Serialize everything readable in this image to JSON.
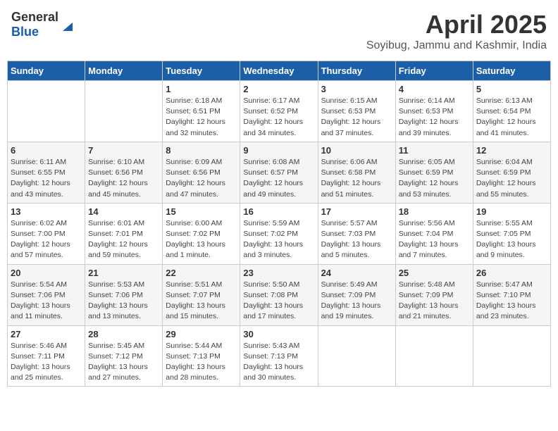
{
  "header": {
    "logo_general": "General",
    "logo_blue": "Blue",
    "title": "April 2025",
    "subtitle": "Soyibug, Jammu and Kashmir, India"
  },
  "days_of_week": [
    "Sunday",
    "Monday",
    "Tuesday",
    "Wednesday",
    "Thursday",
    "Friday",
    "Saturday"
  ],
  "weeks": [
    [
      {
        "day": "",
        "info": ""
      },
      {
        "day": "",
        "info": ""
      },
      {
        "day": "1",
        "info": "Sunrise: 6:18 AM\nSunset: 6:51 PM\nDaylight: 12 hours\nand 32 minutes."
      },
      {
        "day": "2",
        "info": "Sunrise: 6:17 AM\nSunset: 6:52 PM\nDaylight: 12 hours\nand 34 minutes."
      },
      {
        "day": "3",
        "info": "Sunrise: 6:15 AM\nSunset: 6:53 PM\nDaylight: 12 hours\nand 37 minutes."
      },
      {
        "day": "4",
        "info": "Sunrise: 6:14 AM\nSunset: 6:53 PM\nDaylight: 12 hours\nand 39 minutes."
      },
      {
        "day": "5",
        "info": "Sunrise: 6:13 AM\nSunset: 6:54 PM\nDaylight: 12 hours\nand 41 minutes."
      }
    ],
    [
      {
        "day": "6",
        "info": "Sunrise: 6:11 AM\nSunset: 6:55 PM\nDaylight: 12 hours\nand 43 minutes."
      },
      {
        "day": "7",
        "info": "Sunrise: 6:10 AM\nSunset: 6:56 PM\nDaylight: 12 hours\nand 45 minutes."
      },
      {
        "day": "8",
        "info": "Sunrise: 6:09 AM\nSunset: 6:56 PM\nDaylight: 12 hours\nand 47 minutes."
      },
      {
        "day": "9",
        "info": "Sunrise: 6:08 AM\nSunset: 6:57 PM\nDaylight: 12 hours\nand 49 minutes."
      },
      {
        "day": "10",
        "info": "Sunrise: 6:06 AM\nSunset: 6:58 PM\nDaylight: 12 hours\nand 51 minutes."
      },
      {
        "day": "11",
        "info": "Sunrise: 6:05 AM\nSunset: 6:59 PM\nDaylight: 12 hours\nand 53 minutes."
      },
      {
        "day": "12",
        "info": "Sunrise: 6:04 AM\nSunset: 6:59 PM\nDaylight: 12 hours\nand 55 minutes."
      }
    ],
    [
      {
        "day": "13",
        "info": "Sunrise: 6:02 AM\nSunset: 7:00 PM\nDaylight: 12 hours\nand 57 minutes."
      },
      {
        "day": "14",
        "info": "Sunrise: 6:01 AM\nSunset: 7:01 PM\nDaylight: 12 hours\nand 59 minutes."
      },
      {
        "day": "15",
        "info": "Sunrise: 6:00 AM\nSunset: 7:02 PM\nDaylight: 13 hours\nand 1 minute."
      },
      {
        "day": "16",
        "info": "Sunrise: 5:59 AM\nSunset: 7:02 PM\nDaylight: 13 hours\nand 3 minutes."
      },
      {
        "day": "17",
        "info": "Sunrise: 5:57 AM\nSunset: 7:03 PM\nDaylight: 13 hours\nand 5 minutes."
      },
      {
        "day": "18",
        "info": "Sunrise: 5:56 AM\nSunset: 7:04 PM\nDaylight: 13 hours\nand 7 minutes."
      },
      {
        "day": "19",
        "info": "Sunrise: 5:55 AM\nSunset: 7:05 PM\nDaylight: 13 hours\nand 9 minutes."
      }
    ],
    [
      {
        "day": "20",
        "info": "Sunrise: 5:54 AM\nSunset: 7:06 PM\nDaylight: 13 hours\nand 11 minutes."
      },
      {
        "day": "21",
        "info": "Sunrise: 5:53 AM\nSunset: 7:06 PM\nDaylight: 13 hours\nand 13 minutes."
      },
      {
        "day": "22",
        "info": "Sunrise: 5:51 AM\nSunset: 7:07 PM\nDaylight: 13 hours\nand 15 minutes."
      },
      {
        "day": "23",
        "info": "Sunrise: 5:50 AM\nSunset: 7:08 PM\nDaylight: 13 hours\nand 17 minutes."
      },
      {
        "day": "24",
        "info": "Sunrise: 5:49 AM\nSunset: 7:09 PM\nDaylight: 13 hours\nand 19 minutes."
      },
      {
        "day": "25",
        "info": "Sunrise: 5:48 AM\nSunset: 7:09 PM\nDaylight: 13 hours\nand 21 minutes."
      },
      {
        "day": "26",
        "info": "Sunrise: 5:47 AM\nSunset: 7:10 PM\nDaylight: 13 hours\nand 23 minutes."
      }
    ],
    [
      {
        "day": "27",
        "info": "Sunrise: 5:46 AM\nSunset: 7:11 PM\nDaylight: 13 hours\nand 25 minutes."
      },
      {
        "day": "28",
        "info": "Sunrise: 5:45 AM\nSunset: 7:12 PM\nDaylight: 13 hours\nand 27 minutes."
      },
      {
        "day": "29",
        "info": "Sunrise: 5:44 AM\nSunset: 7:13 PM\nDaylight: 13 hours\nand 28 minutes."
      },
      {
        "day": "30",
        "info": "Sunrise: 5:43 AM\nSunset: 7:13 PM\nDaylight: 13 hours\nand 30 minutes."
      },
      {
        "day": "",
        "info": ""
      },
      {
        "day": "",
        "info": ""
      },
      {
        "day": "",
        "info": ""
      }
    ]
  ]
}
